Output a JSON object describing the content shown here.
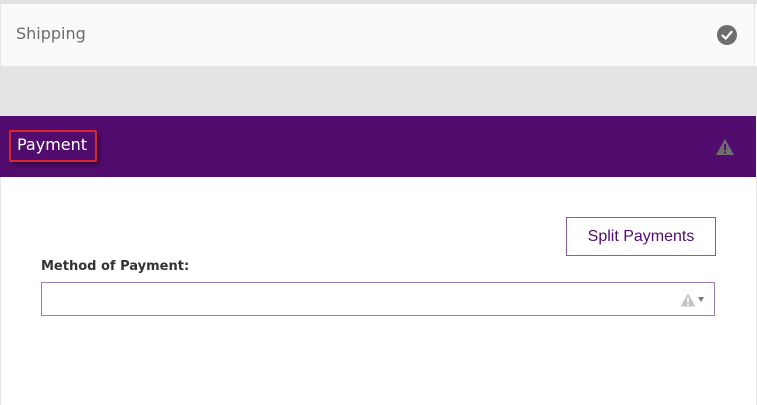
{
  "shipping": {
    "label": "Shipping",
    "status_icon": "check-circle-icon"
  },
  "payment": {
    "label": "Payment",
    "status_icon": "warning-icon",
    "header_color": "#520c6e"
  },
  "split_payments": {
    "label": "Split Payments"
  },
  "method_of_payment": {
    "label": "Method of Payment:",
    "value": "",
    "status_icon": "warning-icon"
  }
}
